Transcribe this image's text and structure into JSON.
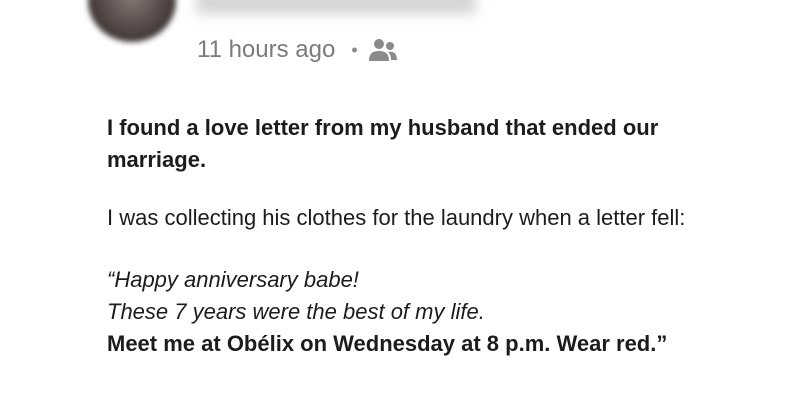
{
  "post": {
    "timestamp": "11 hours ago",
    "separator": "•",
    "audience_icon": "friends-icon",
    "headline": "I found a love letter from my husband that ended our marriage.",
    "paragraph": "I was collecting his clothes for the laundry when a letter fell:",
    "letter_line1": "“Happy anniversary babe!",
    "letter_line2": "These 7 years were the best of my life.",
    "letter_line3": "Meet me at Obélix on Wednesday at 8 p.m. Wear red.”"
  }
}
